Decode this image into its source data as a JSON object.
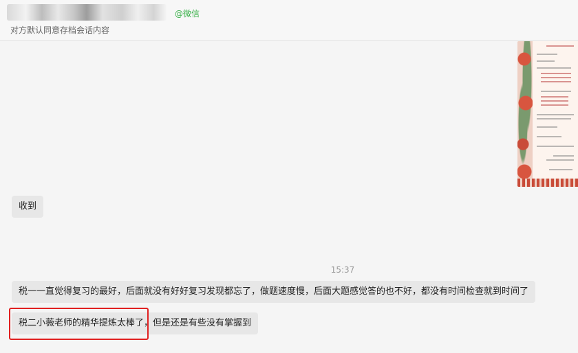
{
  "header": {
    "name_hidden": true,
    "wechat_tag": "@微信",
    "subtitle": "对方默认同意存档会话内容"
  },
  "messages": [
    {
      "type": "image",
      "description_hidden": true
    },
    {
      "type": "text",
      "text": "收到"
    },
    {
      "type": "time",
      "text": "15:37"
    },
    {
      "type": "text",
      "text": "税一一直觉得复习的最好，后面就没有好好复习发现都忘了，做题速度慢，后面大题感觉答的也不好，都没有时间检查就到时间了"
    },
    {
      "type": "text",
      "text": "税二小薇老师的精华提炼太棒了，但是还是有些没有掌握到",
      "highlighted": true
    }
  ],
  "colors": {
    "highlight": "#e02020",
    "wechat_green": "#38b048"
  }
}
